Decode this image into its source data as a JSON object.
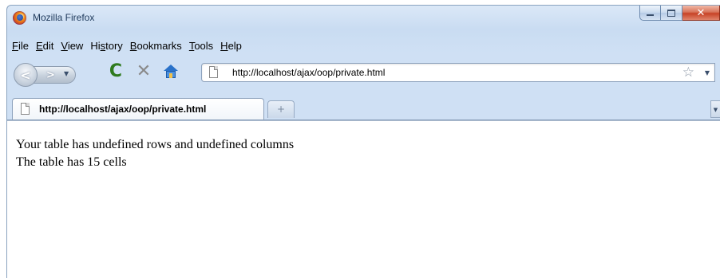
{
  "window": {
    "title": "Mozilla Firefox"
  },
  "menu": {
    "items": [
      {
        "label": "File",
        "accel": "F",
        "rest": "ile"
      },
      {
        "label": "Edit",
        "accel": "E",
        "rest": "dit"
      },
      {
        "label": "View",
        "accel": "V",
        "rest": "iew"
      },
      {
        "label": "History",
        "pre": "Hi",
        "accel": "s",
        "rest": "tory"
      },
      {
        "label": "Bookmarks",
        "accel": "B",
        "rest": "ookmarks"
      },
      {
        "label": "Tools",
        "accel": "T",
        "rest": "ools"
      },
      {
        "label": "Help",
        "accel": "H",
        "rest": "elp"
      }
    ]
  },
  "toolbar": {
    "icons": [
      "back-icon",
      "forward-icon",
      "reload-icon",
      "stop-icon",
      "home-icon",
      "bookmark-star-icon"
    ],
    "reload_color": "#2f7a1e",
    "home_color": "#2a72c9"
  },
  "urlbar": {
    "value": "http://localhost/ajax/oop/private.html"
  },
  "tabs": [
    {
      "label": "http://localhost/ajax/oop/private.html",
      "active": true
    }
  ],
  "content": {
    "line1": "Your table has undefined rows and undefined columns",
    "line2": "The table has 15 cells"
  }
}
